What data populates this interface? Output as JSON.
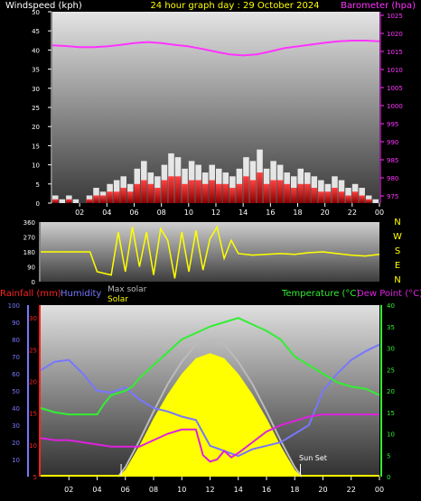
{
  "header": {
    "title": "24 hour graph day : 29 October 2024",
    "windspeed_label": "Windspeed (kph)",
    "barometer_label": "Barometer (hpa)"
  },
  "wind_dir_letters": [
    "N",
    "W",
    "S",
    "E",
    "N"
  ],
  "bottom_labels": {
    "rainfall": "Rainfall (mm)",
    "humidity": "Humidity",
    "max_solar": "Max solar",
    "solar": "Solar",
    "temperature": "Temperature (°C)",
    "dew_point": "Dew Point (°C)",
    "sun_set": "Sun Set"
  },
  "colors": {
    "title": "#ffff00",
    "windspeed": "#ffffff",
    "barometer": "#ff33ff",
    "wind_dir": "#ffff00",
    "rainfall": "#ff2222",
    "humidity": "#7777ff",
    "max_solar": "#bbbbbb",
    "solar": "#ffff00",
    "temperature": "#33ee33",
    "dew_point": "#dd22dd"
  },
  "chart_data": [
    {
      "type": "bar",
      "panel": "wind-barometer",
      "x_ticks": [
        "02",
        "04",
        "06",
        "08",
        "10",
        "12",
        "14",
        "16",
        "18",
        "20",
        "22",
        "00"
      ],
      "x_range_hours": [
        0,
        24
      ],
      "y_left": {
        "label": "Windspeed (kph)",
        "ticks": [
          0,
          5,
          10,
          15,
          20,
          25,
          30,
          35,
          40,
          45,
          50
        ],
        "range": [
          0,
          50
        ]
      },
      "y_right": {
        "label": "Barometer (hpa)",
        "ticks": [
          975,
          980,
          985,
          990,
          995,
          1000,
          1005,
          1010,
          1015,
          1020,
          1025
        ],
        "range": [
          973,
          1026
        ]
      },
      "series": [
        {
          "name": "Barometer (hpa)",
          "type": "line",
          "x": [
            0,
            1,
            2,
            3,
            4,
            5,
            6,
            7,
            8,
            9,
            10,
            11,
            12,
            13,
            14,
            15,
            16,
            17,
            18,
            19,
            20,
            21,
            22,
            23,
            24
          ],
          "y": [
            1016.7,
            1016.5,
            1016.2,
            1016.2,
            1016.4,
            1016.8,
            1017.3,
            1017.6,
            1017.3,
            1016.8,
            1016.4,
            1015.7,
            1014.9,
            1014.2,
            1013.9,
            1014.2,
            1015.0,
            1015.9,
            1016.4,
            1016.9,
            1017.4,
            1017.8,
            1018.0,
            1018.0,
            1017.8
          ]
        },
        {
          "name": "Windspeed gust (kph)",
          "type": "bar",
          "x": [
            0,
            0.5,
            1,
            1.5,
            2,
            2.5,
            3,
            3.5,
            4,
            4.5,
            5,
            5.5,
            6,
            6.5,
            7,
            7.5,
            8,
            8.5,
            9,
            9.5,
            10,
            10.5,
            11,
            11.5,
            12,
            12.5,
            13,
            13.5,
            14,
            14.5,
            15,
            15.5,
            16,
            16.5,
            17,
            17.5,
            18,
            18.5,
            19,
            19.5,
            20,
            20.5,
            21,
            21.5,
            22,
            22.5,
            23,
            23.5
          ],
          "y": [
            2,
            1,
            2,
            1,
            0,
            2,
            4,
            3,
            5,
            6,
            7,
            5,
            9,
            11,
            8,
            7,
            10,
            13,
            12,
            9,
            11,
            10,
            8,
            10,
            9,
            8,
            7,
            9,
            12,
            11,
            14,
            9,
            11,
            10,
            8,
            7,
            9,
            8,
            7,
            6,
            5,
            7,
            6,
            4,
            5,
            4,
            2,
            1
          ]
        },
        {
          "name": "Windspeed average (kph)",
          "type": "bar",
          "x": [
            0,
            0.5,
            1,
            1.5,
            2,
            2.5,
            3,
            3.5,
            4,
            4.5,
            5,
            5.5,
            6,
            6.5,
            7,
            7.5,
            8,
            8.5,
            9,
            9.5,
            10,
            10.5,
            11,
            11.5,
            12,
            12.5,
            13,
            13.5,
            14,
            14.5,
            15,
            15.5,
            16,
            16.5,
            17,
            17.5,
            18,
            18.5,
            19,
            19.5,
            20,
            20.5,
            21,
            21.5,
            22,
            22.5,
            23,
            23.5
          ],
          "y": [
            1,
            0,
            1,
            0,
            0,
            1,
            2,
            2,
            3,
            3,
            4,
            3,
            5,
            6,
            5,
            4,
            6,
            7,
            7,
            5,
            6,
            6,
            5,
            6,
            5,
            5,
            4,
            5,
            7,
            6,
            8,
            5,
            6,
            6,
            5,
            4,
            5,
            5,
            4,
            3,
            3,
            4,
            3,
            2,
            3,
            2,
            1,
            0
          ]
        }
      ]
    },
    {
      "type": "line",
      "panel": "wind-direction",
      "y_ticks": [
        0,
        90,
        180,
        270,
        360
      ],
      "y_range": [
        0,
        360
      ],
      "series": [
        {
          "name": "Wind direction",
          "x": [
            0,
            1,
            2,
            3,
            3.5,
            4,
            5,
            5.5,
            6,
            6.5,
            7,
            7.5,
            8,
            8.5,
            9,
            9.5,
            10,
            10.5,
            11,
            11.5,
            12,
            12.5,
            13,
            13.5,
            14,
            15,
            16,
            17,
            18,
            19,
            20,
            21,
            22,
            23,
            24
          ],
          "y": [
            180,
            180,
            180,
            180,
            180,
            60,
            40,
            300,
            60,
            330,
            90,
            300,
            40,
            320,
            250,
            20,
            300,
            60,
            310,
            70,
            260,
            330,
            140,
            250,
            170,
            160,
            165,
            170,
            165,
            175,
            180,
            170,
            160,
            155,
            165
          ]
        }
      ]
    },
    {
      "type": "line",
      "panel": "temp-humidity-solar",
      "y_rainfall": {
        "label": "Rainfall (mm)",
        "ticks": [
          5,
          10,
          15,
          20,
          25,
          30
        ],
        "range": [
          5,
          32
        ]
      },
      "y_humidity": {
        "label": "Humidity",
        "ticks": [
          10,
          20,
          30,
          40,
          50,
          60,
          70,
          80,
          90,
          100
        ],
        "range": [
          0,
          100
        ]
      },
      "y_temp": {
        "label": "Temperature (°C)",
        "ticks": [
          0,
          5,
          10,
          15,
          20,
          25,
          30,
          35,
          40
        ],
        "range": [
          0,
          40
        ]
      },
      "series": [
        {
          "name": "Temperature (°C)",
          "x": [
            0,
            1,
            2,
            3,
            4,
            4.5,
            5,
            5.5,
            6,
            6.5,
            7,
            8,
            9,
            10,
            11,
            12,
            13,
            14,
            15,
            16,
            17,
            18,
            19,
            20,
            21,
            22,
            23,
            24
          ],
          "y": [
            16,
            15,
            14.5,
            14.5,
            14.5,
            17,
            19,
            19.5,
            20,
            21,
            23,
            26,
            29,
            32,
            33.5,
            35,
            36,
            37,
            35.5,
            34,
            32,
            28,
            26,
            24,
            22,
            21,
            20.5,
            19
          ]
        },
        {
          "name": "Dew Point (°C)",
          "x": [
            0,
            1,
            2,
            3,
            4,
            5,
            6,
            7,
            8,
            9,
            10,
            11,
            11.5,
            12,
            12.5,
            13,
            13.5,
            14,
            15,
            16,
            17,
            18,
            19,
            20,
            21,
            22,
            23,
            24
          ],
          "y": [
            9,
            8.5,
            8.5,
            8,
            7.5,
            7,
            7,
            7,
            8.5,
            10,
            11,
            11,
            5,
            3.5,
            4,
            6,
            4.5,
            5.5,
            8,
            10.5,
            12,
            13,
            14,
            14.5,
            14.5,
            14.5,
            14.5,
            14.5
          ]
        },
        {
          "name": "Humidity",
          "x": [
            0,
            1,
            2,
            3,
            4,
            5,
            6,
            7,
            8,
            9,
            10,
            11,
            12,
            13,
            14,
            15,
            16,
            17,
            18,
            19,
            20,
            21,
            22,
            23,
            24
          ],
          "y": [
            62,
            67,
            68,
            60,
            50,
            49,
            52,
            45,
            40,
            38,
            35,
            33,
            18,
            15,
            12,
            16,
            18,
            20,
            25,
            30,
            50,
            60,
            68,
            73,
            77
          ]
        },
        {
          "name": "Solar",
          "x": [
            5.5,
            6,
            7,
            8,
            9,
            10,
            11,
            12,
            13,
            14,
            15,
            16,
            17,
            18,
            18.5
          ],
          "y": [
            0,
            40,
            180,
            340,
            480,
            600,
            690,
            720,
            690,
            600,
            480,
            340,
            180,
            40,
            0
          ]
        },
        {
          "name": "Max solar",
          "x": [
            5.5,
            6,
            7,
            8,
            9,
            10,
            11,
            12,
            13,
            14,
            15,
            16,
            17,
            18,
            18.5
          ],
          "y": [
            0,
            55,
            210,
            380,
            540,
            670,
            770,
            800,
            770,
            670,
            540,
            380,
            210,
            55,
            0
          ]
        }
      ]
    }
  ]
}
